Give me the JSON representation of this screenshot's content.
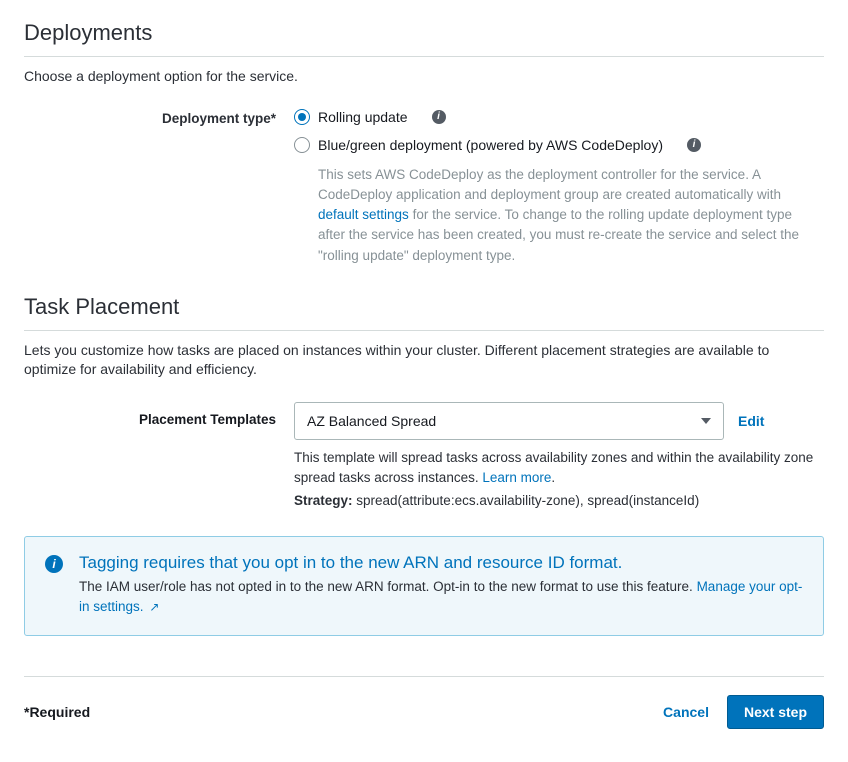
{
  "deployments": {
    "heading": "Deployments",
    "subtext": "Choose a deployment option for the service.",
    "field_label": "Deployment type*",
    "options": {
      "rolling": {
        "label": "Rolling update"
      },
      "bluegreen": {
        "label": "Blue/green deployment (powered by AWS CodeDeploy)",
        "desc_1": "This sets AWS CodeDeploy as the deployment controller for the service. A CodeDeploy application and deployment group are created automatically with ",
        "desc_link": "default settings",
        "desc_2": " for the service. To change to the rolling update deployment type after the service has been created, you must re-create the service and select the \"rolling update\" deployment type."
      }
    }
  },
  "task_placement": {
    "heading": "Task Placement",
    "subtext": "Lets you customize how tasks are placed on instances within your cluster. Different placement strategies are available to optimize for availability and efficiency.",
    "label": "Placement Templates",
    "select_value": "AZ Balanced Spread",
    "edit": "Edit",
    "template_desc_1": "This template will spread tasks across availability zones and within the availability zone spread tasks across instances. ",
    "learn_more": "Learn more",
    "strategy_label": "Strategy:",
    "strategy_value": " spread(attribute:ecs.availability-zone), spread(instanceId)"
  },
  "alert": {
    "title": "Tagging requires that you opt in to the new ARN and resource ID format.",
    "body_1": "The IAM user/role has not opted in to the new ARN format. Opt-in to the new format to use this feature. ",
    "link": "Manage your opt-in settings."
  },
  "footer": {
    "required": "*Required",
    "cancel": "Cancel",
    "next": "Next step"
  }
}
